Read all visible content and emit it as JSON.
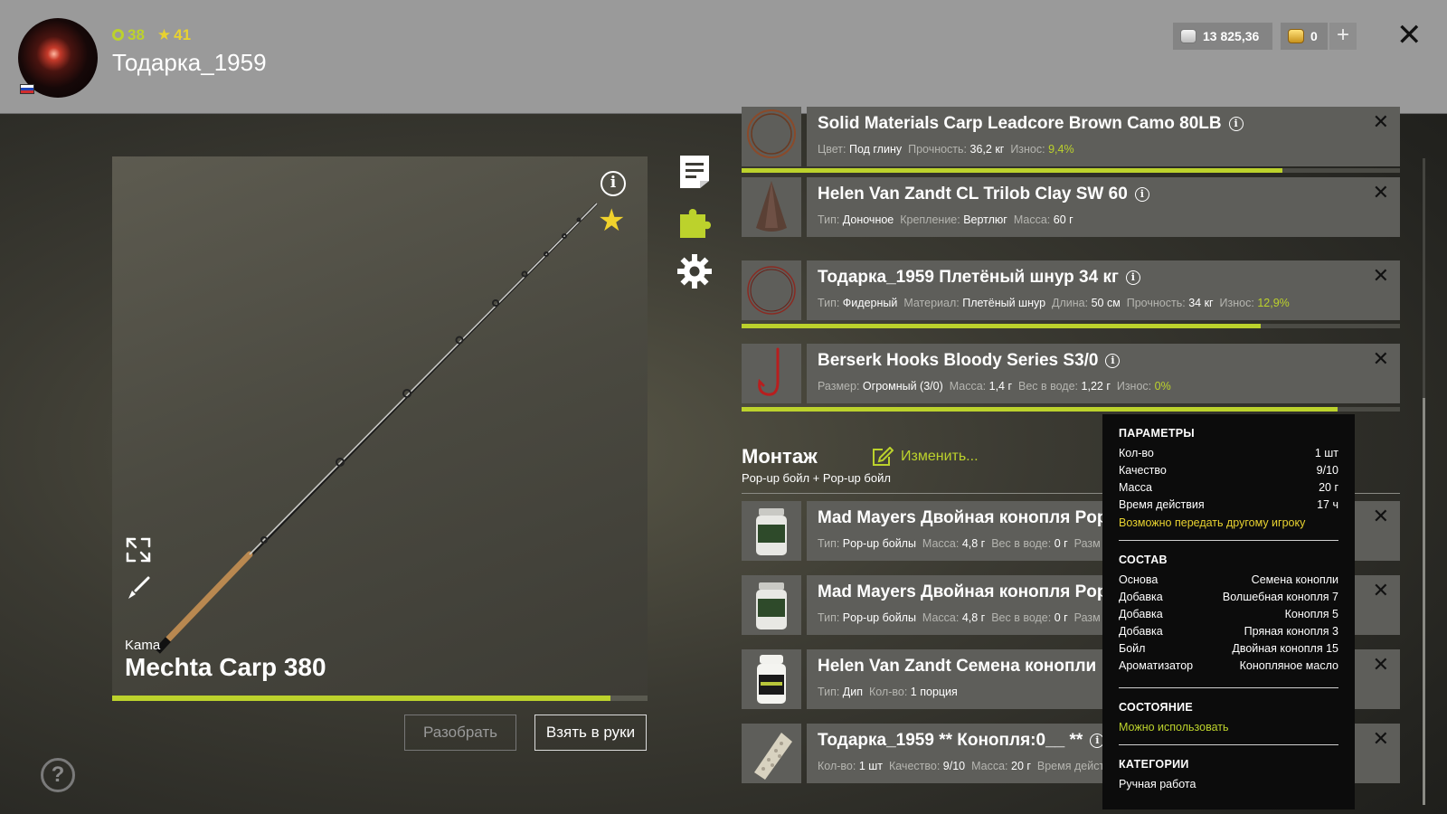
{
  "header": {
    "level": "38",
    "stars": "41",
    "username": "Тодарка_1959",
    "silver": "13 825,36",
    "gold": "0"
  },
  "rod": {
    "brand": "Kama",
    "name": "Mechta Carp 380",
    "wear_fraction": 0.93,
    "disassemble_label": "Разобрать",
    "take_label": "Взять в руки"
  },
  "items": [
    {
      "name": "Solid Materials Carp Leadcore Brown Camo 80LB",
      "props": [
        {
          "k": "Цвет:",
          "v": "Под глину"
        },
        {
          "k": "Прочность:",
          "v": "36,2 кг"
        },
        {
          "k": "Износ:",
          "v": "9,4%",
          "green": true
        }
      ],
      "wear_fraction": 0.907
    },
    {
      "name": "Helen Van Zandt CL Trilob Clay SW 60",
      "props": [
        {
          "k": "Тип:",
          "v": "Доночное"
        },
        {
          "k": "Крепление:",
          "v": "Вертлюг"
        },
        {
          "k": "Масса:",
          "v": "60 г"
        }
      ]
    },
    {
      "name": "Тодарка_1959 Плетёный шнур 34 кг",
      "props": [
        {
          "k": "Тип:",
          "v": "Фидерный"
        },
        {
          "k": "Материал:",
          "v": "Плетёный шнур"
        },
        {
          "k": "Длина:",
          "v": "50 см"
        },
        {
          "k": "Прочность:",
          "v": "34 кг"
        },
        {
          "k": "Износ:",
          "v": "12,9%",
          "green": true
        }
      ],
      "wear_fraction": 0.871
    },
    {
      "name": "Berserk Hooks Bloody Series S3/0",
      "props": [
        {
          "k": "Размер:",
          "v": "Огромный (3/0)"
        },
        {
          "k": "Масса:",
          "v": "1,4 г"
        },
        {
          "k": "Вес в воде:",
          "v": "1,22 г"
        },
        {
          "k": "Износ:",
          "v": "0%",
          "green": true
        }
      ],
      "wear_fraction": 1.0
    }
  ],
  "montage": {
    "title": "Монтаж",
    "edit_label": "Изменить...",
    "subtitle": "Pop-up бойл  +  Pop-up бойл"
  },
  "bait_items": [
    {
      "name": "Mad Mayers Двойная конопля PopUp",
      "props": [
        {
          "k": "Тип:",
          "v": "Pop-up бойлы"
        },
        {
          "k": "Масса:",
          "v": "4,8 г"
        },
        {
          "k": "Вес в воде:",
          "v": "0 г"
        },
        {
          "k": "Разм",
          "v": ""
        }
      ]
    },
    {
      "name": "Mad Mayers Двойная конопля PopUp",
      "props": [
        {
          "k": "Тип:",
          "v": "Pop-up бойлы"
        },
        {
          "k": "Масса:",
          "v": "4,8 г"
        },
        {
          "k": "Вес в воде:",
          "v": "0 г"
        },
        {
          "k": "Разм",
          "v": ""
        }
      ]
    },
    {
      "name": "Helen Van Zandt Семена конопли",
      "props": [
        {
          "k": "Тип:",
          "v": "Дип"
        },
        {
          "k": "Кол-во:",
          "v": "1 порция"
        }
      ]
    },
    {
      "name": "Тодарка_1959 ** Конопля:0__ **",
      "props": [
        {
          "k": "Кол-во:",
          "v": "1 шт"
        },
        {
          "k": "Качество:",
          "v": "9/10"
        },
        {
          "k": "Масса:",
          "v": "20 г"
        },
        {
          "k": "Время дейст",
          "v": ""
        }
      ]
    }
  ],
  "tooltip": {
    "params_title": "ПАРАМЕТРЫ",
    "params": [
      {
        "k": "Кол-во",
        "v": "1 шт"
      },
      {
        "k": "Качество",
        "v": "9/10"
      },
      {
        "k": "Масса",
        "v": "20 г"
      },
      {
        "k": "Время действия",
        "v": "17 ч"
      }
    ],
    "transfer_note": "Возможно передать другому игроку",
    "composition_title": "СОСТАВ",
    "composition": [
      {
        "k": "Основа",
        "v": "Семена конопли"
      },
      {
        "k": "Добавка",
        "v": "Волшебная конопля 7"
      },
      {
        "k": "Добавка",
        "v": "Конопля 5"
      },
      {
        "k": "Добавка",
        "v": "Пряная конопля 3"
      },
      {
        "k": "Бойл",
        "v": "Двойная конопля 15"
      },
      {
        "k": "Ароматизатор",
        "v": "Конопляное масло"
      }
    ],
    "state_title": "СОСТОЯНИЕ",
    "state_value": "Можно использовать",
    "categories_title": "КАТЕГОРИИ",
    "categories_value": "Ручная работа"
  },
  "colors": {
    "accent": "#bcd22c",
    "gold": "#e8d230",
    "card": "#5e5e5a",
    "header": "#9a9a9a"
  },
  "icons": [
    "info-icon",
    "star-icon",
    "expand-icon",
    "brush-icon",
    "help-icon",
    "notes-icon",
    "puzzle-icon",
    "gear-icon",
    "close-icon",
    "edit-icon",
    "silver-coin-icon",
    "gold-coin-icon",
    "plus-icon"
  ]
}
